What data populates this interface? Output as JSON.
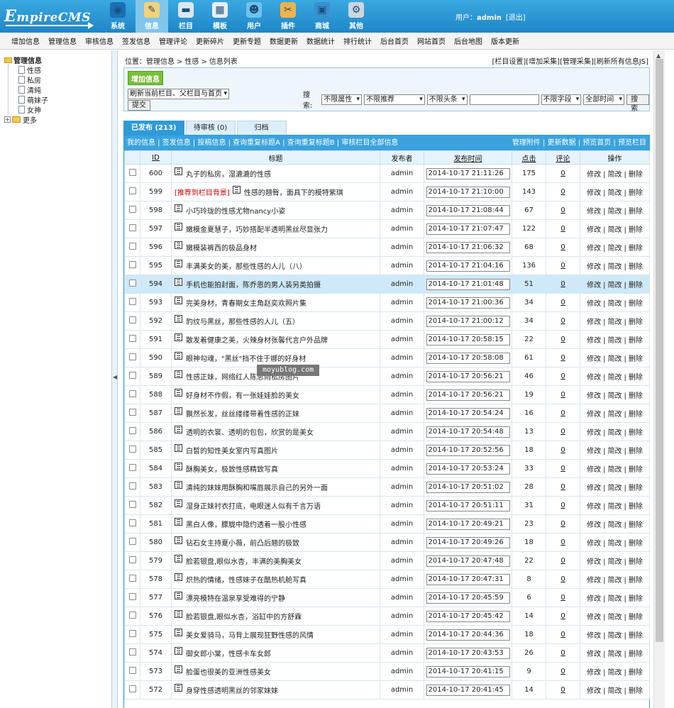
{
  "logo": {
    "text_big": "E",
    "text": "mpireCMS"
  },
  "nav": [
    {
      "label": "系统",
      "icon": "globe-icon"
    },
    {
      "label": "信息",
      "icon": "document-edit-icon",
      "active": true
    },
    {
      "label": "栏目",
      "icon": "folder-icon"
    },
    {
      "label": "模板",
      "icon": "template-icon"
    },
    {
      "label": "用户",
      "icon": "user-icon"
    },
    {
      "label": "插件",
      "icon": "plugin-tools-icon"
    },
    {
      "label": "商城",
      "icon": "shop-icon"
    },
    {
      "label": "其他",
      "icon": "gear-icon"
    }
  ],
  "userinfo": {
    "prefix": "用户：",
    "username": "admin",
    "logout": "[退出]"
  },
  "menu": [
    "增加信息",
    "管理信息",
    "审核信息",
    "签发信息",
    "管理评论",
    "更新碎片",
    "更新专题",
    "数据更新",
    "数据统计",
    "排行统计",
    "后台首页",
    "网站首页",
    "后台地图",
    "版本更新"
  ],
  "tree": {
    "root": "管理信息",
    "children": [
      "性感",
      "私房",
      "清纯",
      "萌妹子",
      "女神"
    ],
    "more": "更多"
  },
  "pathbar": {
    "prefix": "位置：",
    "crumbs": [
      "管理信息",
      "性感",
      "信息列表"
    ],
    "sep": ">",
    "right_links": [
      "[栏目设置]",
      "[增加采集]",
      "[管理采集]",
      "[刷新所有信息JS]"
    ]
  },
  "toolbox": {
    "add_button": "增加信息",
    "refresh_select": "刷新当前栏目、父栏目与首页",
    "submit_button": "提交",
    "search_label": "搜索:",
    "filters": [
      "不限属性",
      "不限推荐",
      "不限头条"
    ],
    "keyword_value": "",
    "field_select": "不限字段",
    "time_select": "全部时间",
    "search_button": "搜索"
  },
  "tabs": [
    "已发布 (213)",
    "待审核 (0)",
    "归档"
  ],
  "linkbar": {
    "left": "我的信息 | 签发信息 | 投稿信息 | 查询重复标题A | 查询重复标题B | 审核栏目全部信息",
    "right": "管理附件 | 更新数据 | 预览首页 | 预览栏目"
  },
  "columns": {
    "id": "ID",
    "title": "标题",
    "publisher": "发布者",
    "time": "发布时间",
    "hits": "点击",
    "comments": "评论",
    "ops": "操作"
  },
  "ops": {
    "edit": "修改",
    "simple_edit": "简改",
    "delete": "删除",
    "sep": "|"
  },
  "rows": [
    {
      "id": "600",
      "title": "丸子的私房，湿漉漉的性感",
      "user": "admin",
      "time": "2014-10-17 21:11:26",
      "hits": "175",
      "comments": "0"
    },
    {
      "id": "599",
      "tag": "[推荐到栏目背景]",
      "title": "性感的翘臀，面具下的模特紫琪",
      "user": "admin",
      "time": "2014-10-17 21:10:00",
      "hits": "143",
      "comments": "0"
    },
    {
      "id": "598",
      "title": "小巧玲珑的性感尤物nancy小姿",
      "user": "admin",
      "time": "2014-10-17 21:08:44",
      "hits": "67",
      "comments": "0"
    },
    {
      "id": "597",
      "title": "嫩模金夏慧子，巧妙搭配半透明黑丝尽显张力",
      "user": "admin",
      "time": "2014-10-17 21:07:47",
      "hits": "122",
      "comments": "0"
    },
    {
      "id": "596",
      "title": "嫩模装裤西的极品身材",
      "user": "admin",
      "time": "2014-10-17 21:06:32",
      "hits": "68",
      "comments": "0"
    },
    {
      "id": "595",
      "title": "丰满美女的美，那些性感的人儿（八）",
      "user": "admin",
      "time": "2014-10-17 21:04:16",
      "hits": "136",
      "comments": "0"
    },
    {
      "id": "594",
      "title": "手机也能拍封面，陈乔恩的男人装另类拍摄",
      "user": "admin",
      "time": "2014-10-17 21:01:48",
      "hits": "51",
      "comments": "0",
      "highlight": true
    },
    {
      "id": "593",
      "title": "完美身材，青春期女主角赵奕欢照片集",
      "user": "admin",
      "time": "2014-10-17 21:00:36",
      "hits": "34",
      "comments": "0"
    },
    {
      "id": "592",
      "title": "豹纹与黑丝，那些性感的人儿（五）",
      "user": "admin",
      "time": "2014-10-17 21:00:12",
      "hits": "34",
      "comments": "0"
    },
    {
      "id": "591",
      "title": "散发着健康之美，火辣身材张馨代言户外品牌",
      "user": "admin",
      "time": "2014-10-17 20:58:15",
      "hits": "22",
      "comments": "0"
    },
    {
      "id": "590",
      "title": "眼神勾魂，\"黑丝\"挡不住于娜的好身材",
      "user": "admin",
      "time": "2014-10-17 20:58:08",
      "hits": "61",
      "comments": "0"
    },
    {
      "id": "589",
      "title": "性感正妹，网络红人陈思雨私房图片",
      "user": "admin",
      "time": "2014-10-17 20:56:21",
      "hits": "46",
      "comments": "0"
    },
    {
      "id": "588",
      "title": "好身材不作假，有一张娃娃脸的美女",
      "user": "admin",
      "time": "2014-10-17 20:56:21",
      "hits": "19",
      "comments": "0"
    },
    {
      "id": "587",
      "title": "飘然长发，丝丝缕缕带着性感的正妹",
      "user": "admin",
      "time": "2014-10-17 20:54:24",
      "hits": "16",
      "comments": "0"
    },
    {
      "id": "586",
      "title": "透明的衣裳、透明的包包，欣赏的是美女",
      "user": "admin",
      "time": "2014-10-17 20:54:48",
      "hits": "13",
      "comments": "0"
    },
    {
      "id": "585",
      "title": "白皙的知性美女室内写真图片",
      "user": "admin",
      "time": "2014-10-17 20:52:56",
      "hits": "18",
      "comments": "0"
    },
    {
      "id": "584",
      "title": "酥胸美女，极致性感精致写真",
      "user": "admin",
      "time": "2014-10-17 20:53:24",
      "hits": "33",
      "comments": "0"
    },
    {
      "id": "583",
      "title": "清纯的妹妹用酥胸和嘴唇展示自己的另外一面",
      "user": "admin",
      "time": "2014-10-17 20:51:02",
      "hits": "28",
      "comments": "0"
    },
    {
      "id": "582",
      "title": "湿身正妹衬衣打底，电眼迷人似有千言万语",
      "user": "admin",
      "time": "2014-10-17 20:51:11",
      "hits": "31",
      "comments": "0"
    },
    {
      "id": "581",
      "title": "黑白人像，朦胧中隐约透着一股小性感",
      "user": "admin",
      "time": "2014-10-17 20:49:21",
      "hits": "23",
      "comments": "0"
    },
    {
      "id": "580",
      "title": "钻石女主持夏小薇，前凸后翘的极致",
      "user": "admin",
      "time": "2014-10-17 20:49:26",
      "hits": "18",
      "comments": "0"
    },
    {
      "id": "579",
      "title": "脸若银盘,眼似水杏，丰满的美胸美女",
      "user": "admin",
      "time": "2014-10-17 20:47:48",
      "hits": "22",
      "comments": "0"
    },
    {
      "id": "578",
      "title": "炽热的情绪，性感妹子在酷热机舱写真",
      "user": "admin",
      "time": "2014-10-17 20:47:31",
      "hits": "8",
      "comments": "0"
    },
    {
      "id": "577",
      "title": "漂亮模特在温泉享受难得的宁静",
      "user": "admin",
      "time": "2014-10-17 20:45:59",
      "hits": "6",
      "comments": "0"
    },
    {
      "id": "576",
      "title": "脸若银盘,眼似水杏，浴缸中的方舒霖",
      "user": "admin",
      "time": "2014-10-17 20:45:42",
      "hits": "14",
      "comments": "0"
    },
    {
      "id": "575",
      "title": "美女爱骑马，马背上展现狂野性感的风情",
      "user": "admin",
      "time": "2014-10-17 20:44:36",
      "hits": "18",
      "comments": "0"
    },
    {
      "id": "574",
      "title": "御女郎小棠，性感卡车女郎",
      "user": "admin",
      "time": "2014-10-17 20:43:53",
      "hits": "26",
      "comments": "0"
    },
    {
      "id": "573",
      "title": "脸蛋也很美的亚洲性感美女",
      "user": "admin",
      "time": "2014-10-17 20:41:15",
      "hits": "9",
      "comments": "0"
    },
    {
      "id": "572",
      "title": "身穿性感透明黑丝的邻家妹妹",
      "user": "admin",
      "time": "2014-10-17 20:41:45",
      "hits": "14",
      "comments": "0"
    }
  ],
  "watermark": "moyublog.com"
}
